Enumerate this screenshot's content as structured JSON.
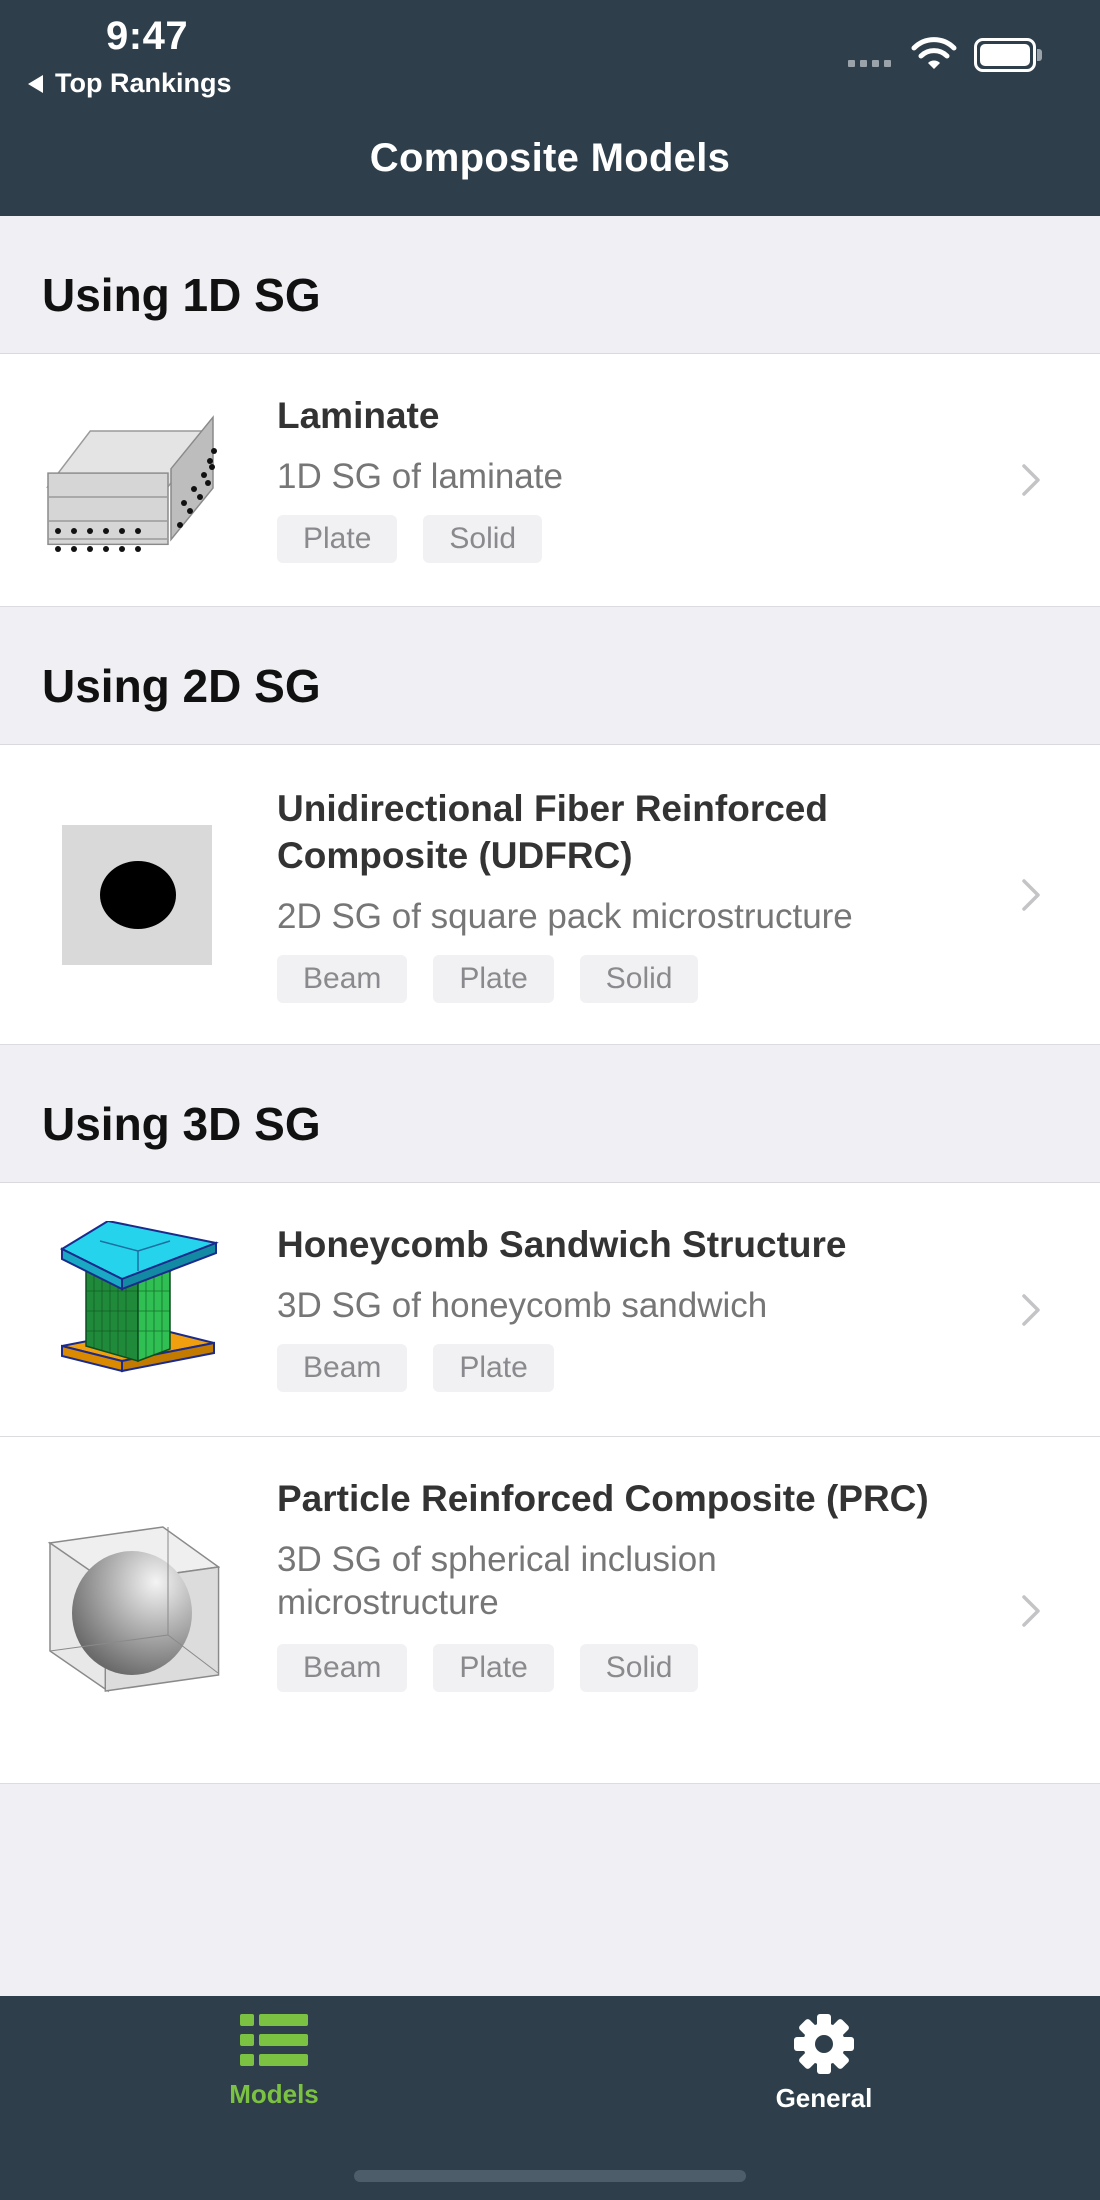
{
  "status_bar": {
    "time": "9:47"
  },
  "nav": {
    "back_label": "Top Rankings",
    "title": "Composite Models"
  },
  "sections": [
    {
      "header": "Using 1D SG",
      "items": [
        {
          "title": "Laminate",
          "subtitle": "1D SG of laminate",
          "tags": [
            "Plate",
            "Solid"
          ],
          "icon": "laminate-icon"
        }
      ]
    },
    {
      "header": "Using 2D SG",
      "items": [
        {
          "title": "Unidirectional Fiber Reinforced Composite (UDFRC)",
          "subtitle": "2D SG of square pack microstructure",
          "tags": [
            "Beam",
            "Plate",
            "Solid"
          ],
          "icon": "square-pack-fiber-icon"
        }
      ]
    },
    {
      "header": "Using 3D SG",
      "items": [
        {
          "title": "Honeycomb Sandwich Structure",
          "subtitle": "3D SG of honeycomb sandwich",
          "tags": [
            "Beam",
            "Plate"
          ],
          "icon": "honeycomb-sandwich-icon"
        },
        {
          "title": "Particle Reinforced Composite (PRC)",
          "subtitle": "3D SG of spherical inclusion microstructure",
          "tags": [
            "Beam",
            "Plate",
            "Solid"
          ],
          "icon": "spherical-inclusion-icon"
        }
      ]
    }
  ],
  "tabbar": {
    "tabs": [
      {
        "label": "Models",
        "icon": "list-icon",
        "active": true
      },
      {
        "label": "General",
        "icon": "gear-icon",
        "active": false
      }
    ]
  },
  "colors": {
    "header_bg": "#2e3f4b",
    "page_bg": "#efeff4",
    "active_tab": "#7cc242",
    "inactive_tab": "#ffffff"
  }
}
